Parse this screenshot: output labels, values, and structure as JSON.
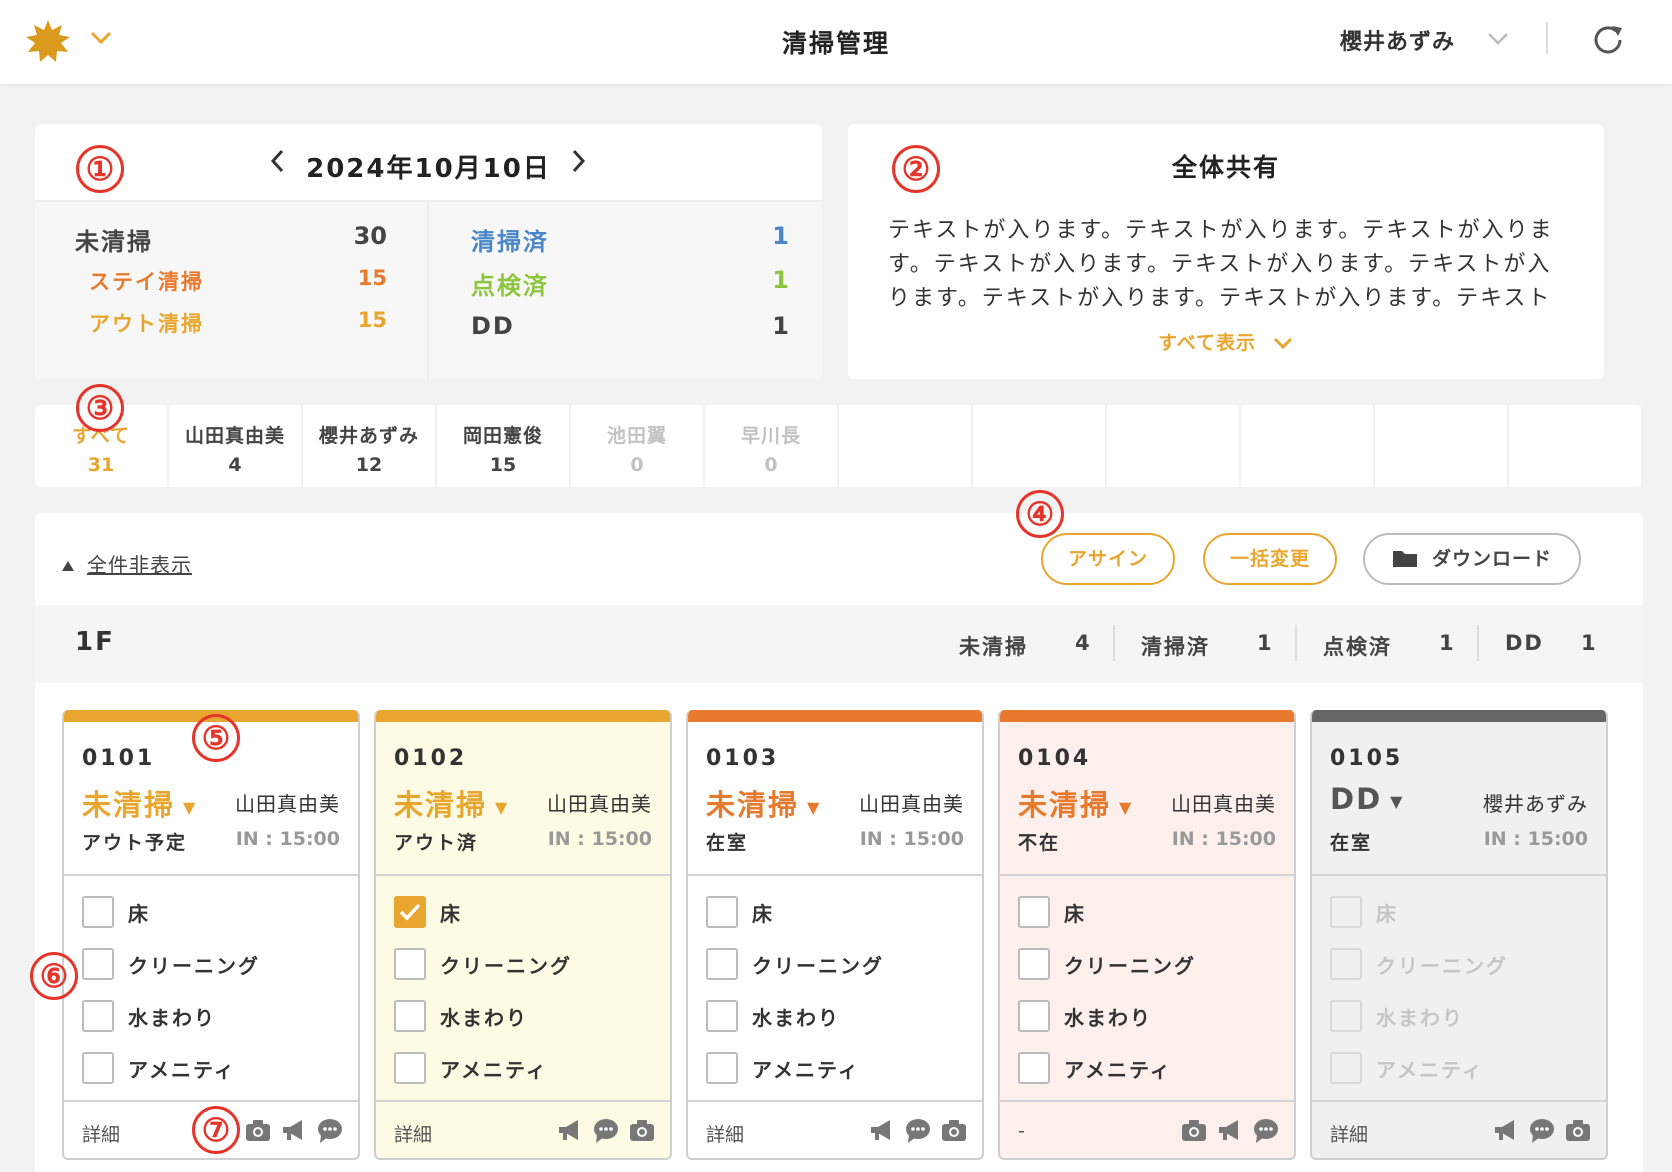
{
  "header": {
    "title": "清掃管理",
    "user_name": "櫻井あずみ"
  },
  "summary": {
    "date": "2024年10月10日",
    "left": [
      {
        "label": "未清掃",
        "value": "30",
        "color": "#444444"
      },
      {
        "label": "ステイ清掃",
        "value": "15",
        "color": "#e87a2e"
      },
      {
        "label": "アウト清掃",
        "value": "15",
        "color": "#e8a62e"
      }
    ],
    "right": [
      {
        "label": "清掃済",
        "value": "1",
        "color": "#4a86c8"
      },
      {
        "label": "点検済",
        "value": "1",
        "color": "#8cc63f"
      },
      {
        "label": "DD",
        "value": "1",
        "color": "#444444"
      }
    ]
  },
  "shared": {
    "title": "全体共有",
    "text": "テキストが入ります。テキストが入ります。テキストが入ります。テキストが入ります。テキストが入ります。テキストが入ります。テキストが入ります。テキストが入ります。テキスト",
    "show_all": "すべて表示"
  },
  "tabs": [
    {
      "name": "すべて",
      "count": "31",
      "state": "active"
    },
    {
      "name": "山田真由美",
      "count": "4",
      "state": "normal"
    },
    {
      "name": "櫻井あずみ",
      "count": "12",
      "state": "normal"
    },
    {
      "name": "岡田憲俊",
      "count": "15",
      "state": "normal"
    },
    {
      "name": "池田翼",
      "count": "0",
      "state": "disabled"
    },
    {
      "name": "早川長",
      "count": "0",
      "state": "disabled"
    }
  ],
  "toolbar": {
    "toggle_label": "全件非表示",
    "assign": "アサイン",
    "bulk_change": "一括変更",
    "download": "ダウンロード"
  },
  "floor": {
    "name": "1F",
    "stats": [
      {
        "label": "未清掃",
        "value": "4"
      },
      {
        "label": "清掃済",
        "value": "1"
      },
      {
        "label": "点検済",
        "value": "1"
      },
      {
        "label": "DD",
        "value": "1"
      }
    ]
  },
  "checklist_labels": [
    "床",
    "クリーニング",
    "水まわり",
    "アメニティ"
  ],
  "rooms": [
    {
      "no": "0101",
      "status": "未清掃",
      "status_color": "#e8a62e",
      "bar_color": "#e8a62e",
      "bg": "#ffffff",
      "staff": "山田真由美",
      "occupancy": "アウト予定",
      "checkin": "IN : 15:00",
      "checks": [
        false,
        false,
        false,
        false
      ],
      "detail": "詳細",
      "icons": [
        "camera-icon",
        "megaphone-icon",
        "chat-icon"
      ]
    },
    {
      "no": "0102",
      "status": "未清掃",
      "status_color": "#e8a62e",
      "bar_color": "#e8a62e",
      "bg": "#fdfbe3",
      "staff": "山田真由美",
      "occupancy": "アウト済",
      "checkin": "IN : 15:00",
      "checks": [
        true,
        false,
        false,
        false
      ],
      "detail": "詳細",
      "icons": [
        "megaphone-icon",
        "chat-icon",
        "camera-icon"
      ]
    },
    {
      "no": "0103",
      "status": "未清掃",
      "status_color": "#e87a2e",
      "bar_color": "#e87a2e",
      "bg": "#ffffff",
      "staff": "山田真由美",
      "occupancy": "在室",
      "checkin": "IN : 15:00",
      "checks": [
        false,
        false,
        false,
        false
      ],
      "detail": "詳細",
      "icons": [
        "megaphone-icon",
        "chat-icon",
        "camera-icon"
      ]
    },
    {
      "no": "0104",
      "status": "未清掃",
      "status_color": "#e87a2e",
      "bar_color": "#e87a2e",
      "bg": "#fdf0ec",
      "staff": "山田真由美",
      "occupancy": "不在",
      "checkin": "IN : 15:00",
      "checks": [
        false,
        false,
        false,
        false
      ],
      "detail": "-",
      "icons": [
        "camera-icon",
        "megaphone-icon",
        "chat-icon"
      ]
    },
    {
      "no": "0105",
      "status": "DD",
      "status_color": "#555555",
      "bar_color": "#666666",
      "bg": "#f0f0f0",
      "staff": "櫻井あずみ",
      "occupancy": "在室",
      "checkin": "IN : 15:00",
      "checks": [
        false,
        false,
        false,
        false
      ],
      "detail": "詳細",
      "icons": [
        "megaphone-icon",
        "chat-icon",
        "camera-icon"
      ],
      "disabled": true
    }
  ],
  "annotations": [
    "①",
    "②",
    "③",
    "④",
    "⑤",
    "⑥",
    "⑦"
  ]
}
